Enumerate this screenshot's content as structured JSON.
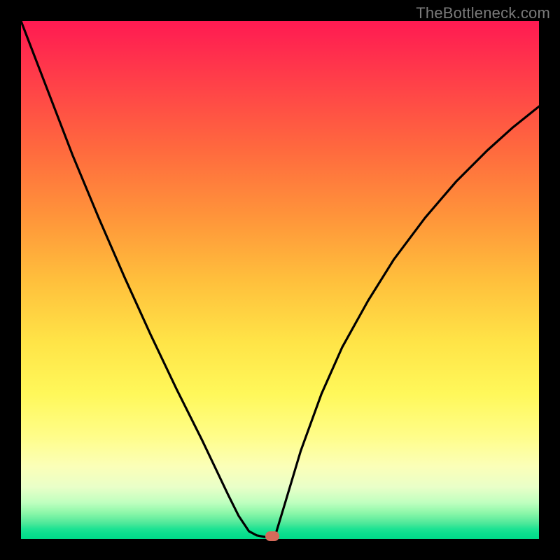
{
  "watermark": "TheBottleneck.com",
  "colors": {
    "frame": "#000000",
    "curve_stroke": "#000000",
    "marker_fill": "#d46a5a"
  },
  "chart_data": {
    "type": "line",
    "title": "",
    "xlabel": "",
    "ylabel": "",
    "xlim": [
      0,
      1
    ],
    "ylim": [
      0,
      1
    ],
    "curve_left": {
      "name": "left-branch",
      "x": [
        0.0,
        0.05,
        0.1,
        0.15,
        0.2,
        0.25,
        0.3,
        0.35,
        0.4,
        0.42,
        0.44,
        0.455
      ],
      "y": [
        1.0,
        0.87,
        0.74,
        0.62,
        0.505,
        0.395,
        0.29,
        0.19,
        0.085,
        0.045,
        0.015,
        0.007
      ]
    },
    "plateau": {
      "name": "minimum-plateau",
      "x": [
        0.455,
        0.47,
        0.49
      ],
      "y": [
        0.007,
        0.004,
        0.004
      ]
    },
    "curve_right": {
      "name": "right-branch",
      "x": [
        0.49,
        0.51,
        0.54,
        0.58,
        0.62,
        0.67,
        0.72,
        0.78,
        0.84,
        0.9,
        0.95,
        1.0
      ],
      "y": [
        0.004,
        0.07,
        0.17,
        0.28,
        0.37,
        0.46,
        0.54,
        0.62,
        0.69,
        0.75,
        0.795,
        0.835
      ]
    },
    "marker": {
      "x": 0.485,
      "y": 0.005
    }
  }
}
